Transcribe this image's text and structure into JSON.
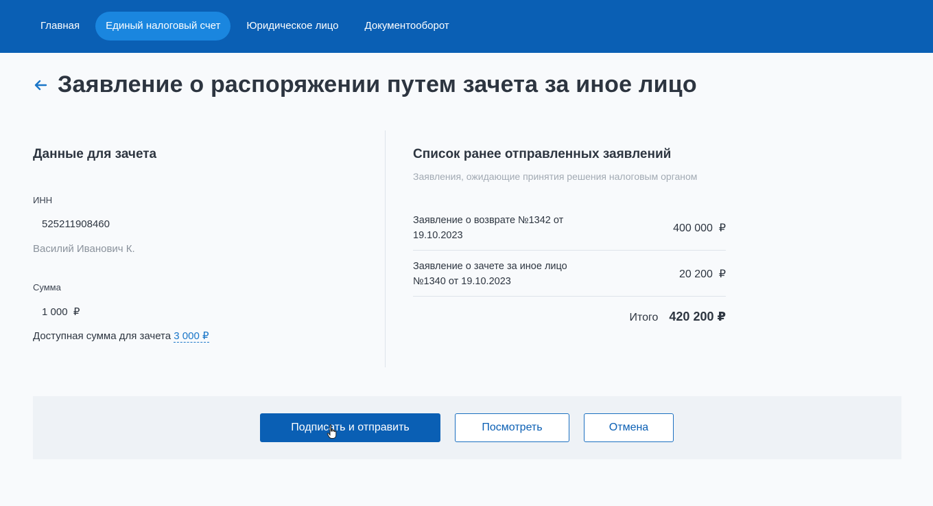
{
  "nav": {
    "items": [
      {
        "label": "Главная"
      },
      {
        "label": "Единый налоговый счет"
      },
      {
        "label": "Юридическое лицо"
      },
      {
        "label": "Документооборот"
      }
    ],
    "active_index": 1
  },
  "page": {
    "title": "Заявление о распоряжении путем зачета за иное лицо"
  },
  "left": {
    "section_title": "Данные для зачета",
    "inn_label": "ИНН",
    "inn_value": "525211908460",
    "person_name": "Василий Иванович К.",
    "sum_label": "Сумма",
    "sum_value": "1 000  ₽",
    "available_text": "Доступная сумма для зачета",
    "available_amount": "3 000 ₽"
  },
  "right": {
    "section_title": "Список ранее отправленных заявлений",
    "subtitle": "Заявления, ожидающие принятия решения налоговым органом",
    "applications": [
      {
        "name": "Заявление о возврате №1342 от 19.10.2023",
        "amount": "400 000  ₽"
      },
      {
        "name": "Заявление о зачете за иное лицо №1340 от 19.10.2023",
        "amount": "20 200  ₽"
      }
    ],
    "total_label": "Итого",
    "total_value": "420 200 ₽"
  },
  "actions": {
    "sign_send": "Подписать и отправить",
    "view": "Посмотреть",
    "cancel": "Отмена"
  },
  "colors": {
    "header_bg": "#0a5fb4",
    "active_tab": "#1a86df",
    "link": "#1a76c8"
  },
  "icons": {
    "back": "arrow-left-icon",
    "cursor": "hand-pointer-icon"
  }
}
